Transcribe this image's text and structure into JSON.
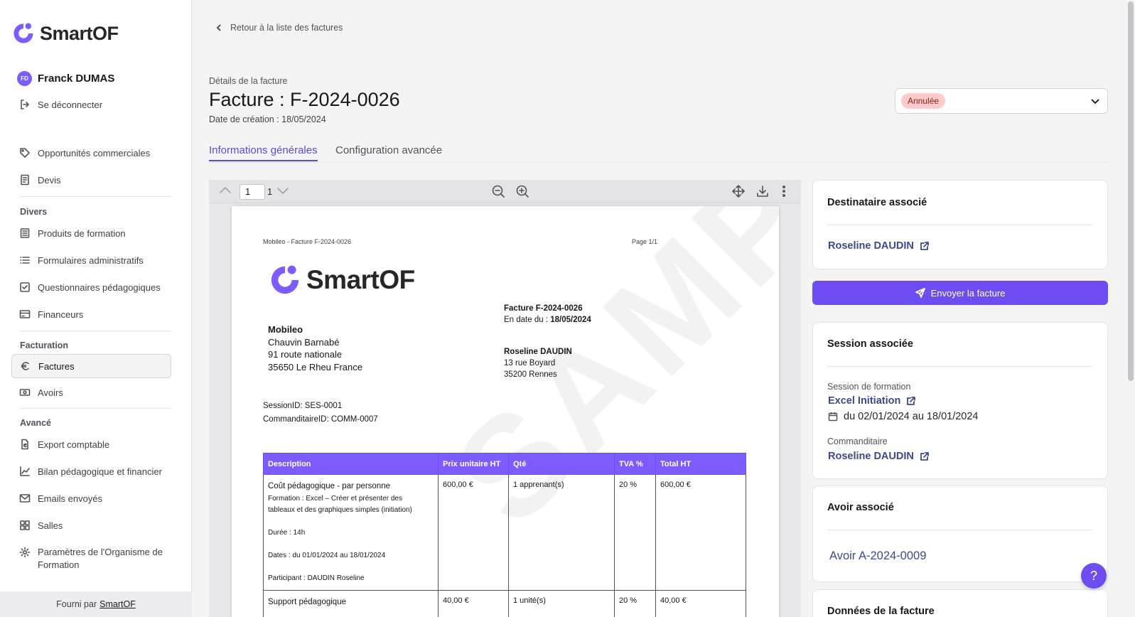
{
  "brand": {
    "name": "SmartOF",
    "accent": "#7c5cff"
  },
  "user": {
    "initials": "FD",
    "name": "Franck DUMAS",
    "logout": "Se déconnecter"
  },
  "nav": {
    "opportunities": "Opportunités commerciales",
    "quotes": "Devis",
    "section_misc": "Divers",
    "training_products": "Produits de formation",
    "admin_forms": "Formulaires administratifs",
    "questionnaires": "Questionnaires pédagogiques",
    "funders": "Financeurs",
    "section_billing": "Facturation",
    "invoices": "Factures",
    "credits": "Avoirs",
    "section_advanced": "Avancé",
    "export": "Export comptable",
    "report": "Bilan pédagogique et financier",
    "emails": "Emails envoyés",
    "rooms": "Salles",
    "settings_line1": "Paramètres de l'Organisme de",
    "settings_line2": "Formation"
  },
  "footer": {
    "prefix": "Fourni par",
    "link": "SmartOF"
  },
  "header": {
    "back": "Retour à la liste des factures",
    "subtitle": "Détails de la facture",
    "title": "Facture : F-2024-0026",
    "created": "Date de création : 18/05/2024",
    "status": "Annulée"
  },
  "tabs": {
    "general": "Informations générales",
    "advanced": "Configuration avancée"
  },
  "viewer": {
    "page": "1",
    "total": "1"
  },
  "pdf": {
    "header_left": "Mobileo - Facture F-2024-0026",
    "header_right": "Page 1/1",
    "invoice_no": "Facture F-2024-0026",
    "date_prefix": "En date du : ",
    "date": "18/05/2024",
    "issuer": {
      "name": "Mobileo",
      "contact": "Chauvin Barnabé",
      "street": "91 route nationale",
      "city": "35650 Le Rheu France"
    },
    "recipient": {
      "name": "Roseline DAUDIN",
      "street": "13 rue Boyard",
      "city": "35200 Rennes"
    },
    "session_id": "SessionID: SES-0001",
    "sponsor_id": "CommanditaireID: COMM-0007",
    "watermark": "SAMPLE",
    "columns": [
      "Description",
      "Prix unitaire HT",
      "Qté",
      "TVA %",
      "Total HT"
    ],
    "rows": [
      {
        "title": "Coût pédagogique - par personne",
        "lines": [
          "Formation : Excel – Créer et présenter des",
          "tableaux et des graphiques simples (initiation)",
          "",
          "Durée : 14h",
          "",
          "Dates : du 01/01/2024 au 18/01/2024",
          "",
          "Participant : DAUDIN Roseline"
        ],
        "price": "600,00 €",
        "qty": "1 apprenant(s)",
        "vat": "20 %",
        "total": "600,00 €"
      },
      {
        "title": "Support pédagogique",
        "lines": [],
        "price": "40,00 €",
        "qty": "1 unité(s)",
        "vat": "20 %",
        "total": "40,00 €"
      }
    ]
  },
  "cards": {
    "recipient_title": "Destinataire associé",
    "recipient_link": "Roseline DAUDIN",
    "send": "Envoyer la facture",
    "session_title": "Session associée",
    "session_label": "Session de formation",
    "session_link": "Excel Initiation",
    "session_dates": "du 02/01/2024 au 18/01/2024",
    "sponsor_label": "Commanditaire",
    "sponsor_link": "Roseline DAUDIN",
    "credit_title": "Avoir associé",
    "credit_link": "Avoir A-2024-0009",
    "invoice_data_title": "Données de la facture"
  },
  "help": "?"
}
